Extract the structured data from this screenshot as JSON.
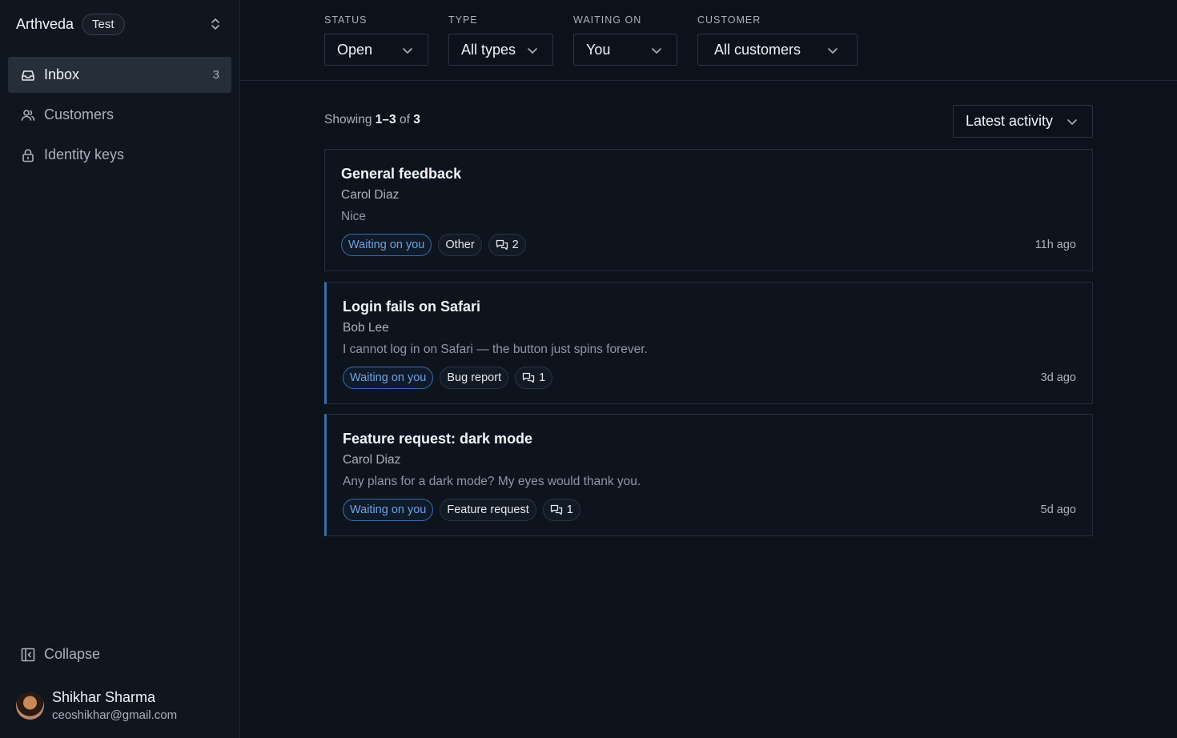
{
  "workspace": {
    "name": "Arthveda",
    "badge": "Test"
  },
  "sidebar": {
    "items": [
      {
        "label": "Inbox",
        "count": "3"
      },
      {
        "label": "Customers"
      },
      {
        "label": "Identity keys"
      }
    ],
    "collapse_label": "Collapse"
  },
  "user": {
    "name": "Shikhar Sharma",
    "email": "ceoshikhar@gmail.com"
  },
  "filters": {
    "status": {
      "label": "STATUS",
      "value": "Open"
    },
    "type": {
      "label": "TYPE",
      "value": "All types"
    },
    "waiting_on": {
      "label": "WAITING ON",
      "value": "You"
    },
    "customer": {
      "label": "CUSTOMER",
      "value": "All customers"
    }
  },
  "list": {
    "showing_prefix": "Showing",
    "range": "1–3",
    "of_text": "of",
    "total": "3",
    "sort_label": "Latest activity"
  },
  "conversations": [
    {
      "title": "General feedback",
      "author": "Carol Diaz",
      "body": "Nice",
      "status_tag": "Waiting on you",
      "type_tag": "Other",
      "replies": "2",
      "time": "11h ago",
      "unread": false
    },
    {
      "title": "Login fails on Safari",
      "author": "Bob Lee",
      "body": "I cannot log in on Safari — the button just spins forever.",
      "status_tag": "Waiting on you",
      "type_tag": "Bug report",
      "replies": "1",
      "time": "3d ago",
      "unread": true
    },
    {
      "title": "Feature request: dark mode",
      "author": "Carol Diaz",
      "body": "Any plans for a dark mode? My eyes would thank you.",
      "status_tag": "Waiting on you",
      "type_tag": "Feature request",
      "replies": "1",
      "time": "5d ago",
      "unread": true
    }
  ],
  "colors": {
    "accent": "#3a6ea8",
    "waiting_text": "#6fa3de",
    "background": "#0b121c",
    "sidebar": "#0f1620"
  }
}
